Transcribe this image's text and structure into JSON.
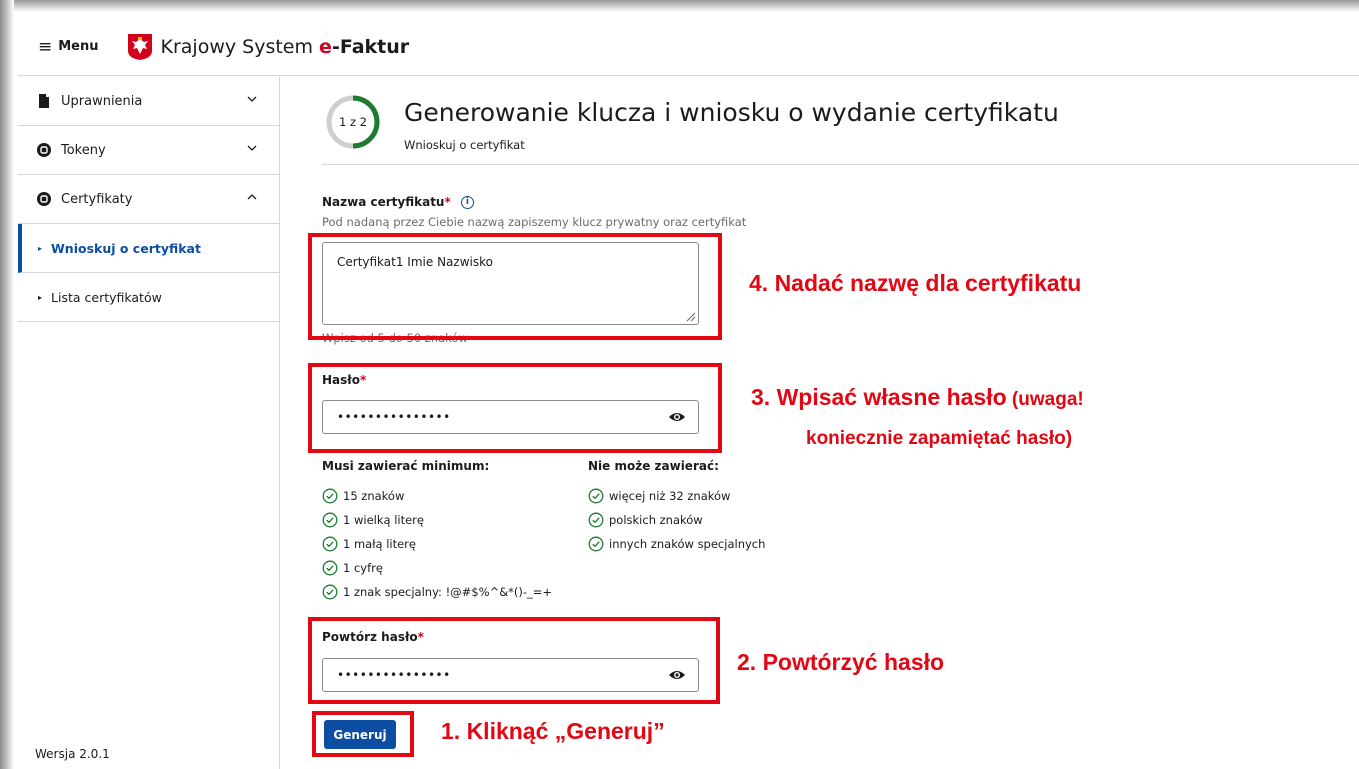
{
  "header": {
    "menu_label": "Menu",
    "brand_prefix": "Krajowy System ",
    "brand_e": "e",
    "brand_suffix": "-Faktur"
  },
  "sidebar": {
    "items": [
      {
        "label": "Uprawnienia",
        "icon": "document-icon",
        "expanded": false
      },
      {
        "label": "Tokeny",
        "icon": "token-icon",
        "expanded": false
      },
      {
        "label": "Certyfikaty",
        "icon": "certificate-icon",
        "expanded": true
      }
    ],
    "subitems": [
      {
        "label": "Wnioskuj o certyfikat",
        "active": true
      },
      {
        "label": "Lista certyfikatów",
        "active": false
      }
    ],
    "version": "Wersja 2.0.1"
  },
  "main": {
    "step": {
      "text": "1 z 2",
      "current": 1,
      "total": 2
    },
    "title": "Generowanie klucza i wniosku o wydanie certyfikatu",
    "subtitle": "Wnioskuj o certyfikat",
    "cert_name": {
      "label": "Nazwa certyfikatu",
      "required_mark": "*",
      "hint": "Pod nadaną przez Ciebie nazwą zapiszemy klucz prywatny oraz certyfikat",
      "value": "Certyfikat1 Imie Nazwisko",
      "counter_hint": "Wpisz od 5 do 50 znaków"
    },
    "password": {
      "label": "Hasło",
      "required_mark": "*",
      "masked_value": "•••••••••••••••"
    },
    "must_contain": {
      "heading": "Musi zawierać minimum:",
      "rules": [
        "15 znaków",
        "1 wielką literę",
        "1 małą literę",
        "1 cyfrę",
        "1 znak specjalny: !@#$%^&*()-_=+"
      ]
    },
    "must_not_contain": {
      "heading": "Nie może zawierać:",
      "rules": [
        "więcej niż 32 znaków",
        "polskich znaków",
        "innych znaków specjalnych"
      ]
    },
    "repeat_password": {
      "label": "Powtórz hasło",
      "required_mark": "*",
      "masked_value": "•••••••••••••••"
    },
    "generate_button": "Generuj"
  },
  "annotations": {
    "a4": "4.  Nadać nazwę dla certyfikatu",
    "a3_line1": "3.  Wpisać własne hasło",
    "a3_line1_suffix": " (uwaga!",
    "a3_line2": "koniecznie zapamiętać hasło)",
    "a2": "2.  Powtórzyć hasło",
    "a1": "1.  Kliknąć „Generuj”",
    "color": "#e30613"
  },
  "colors": {
    "accent": "#0b4ea2",
    "required": "#d2001f",
    "success": "#1e7a2e",
    "step_progress": "#1e7a2e",
    "step_track": "#cfcfcf"
  }
}
